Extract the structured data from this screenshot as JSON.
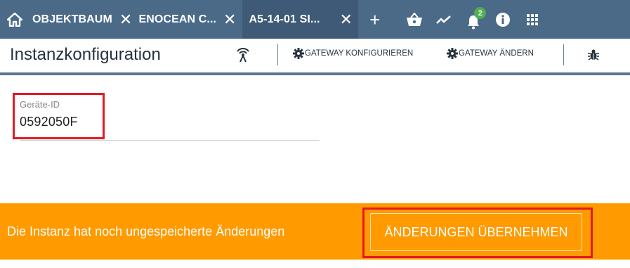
{
  "tabs": [
    {
      "label": "OBJEKTBAUM",
      "active": false
    },
    {
      "label": "ENOCEAN C...",
      "active": false
    },
    {
      "label": "A5-14-01 SI...",
      "active": true
    }
  ],
  "tab_close_glyph": "✕",
  "add_tab_glyph": "+",
  "top_icons": [
    "home-icon",
    "basket-icon",
    "trend-icon",
    "bell-icon",
    "info-icon",
    "apps-grid-icon"
  ],
  "notifications": {
    "count": "2",
    "color": "#4caf50"
  },
  "toolbar": {
    "title": "Instanzkonfiguration",
    "configure_gateway_label": "GATEWAY KONFIGURIEREN",
    "change_gateway_label": "GATEWAY ÄNDERN"
  },
  "form": {
    "device_id_label": "Geräte-ID",
    "device_id_value": "0592050F"
  },
  "banner": {
    "message": "Die Instanz hat noch ungespeicherte Änderungen",
    "apply_button_label": "ÄNDERUNGEN ÜBERNEHMEN",
    "color": "#ff9a00"
  },
  "colors": {
    "topbar": "#4a6a88",
    "highlight": "#e01b22"
  }
}
